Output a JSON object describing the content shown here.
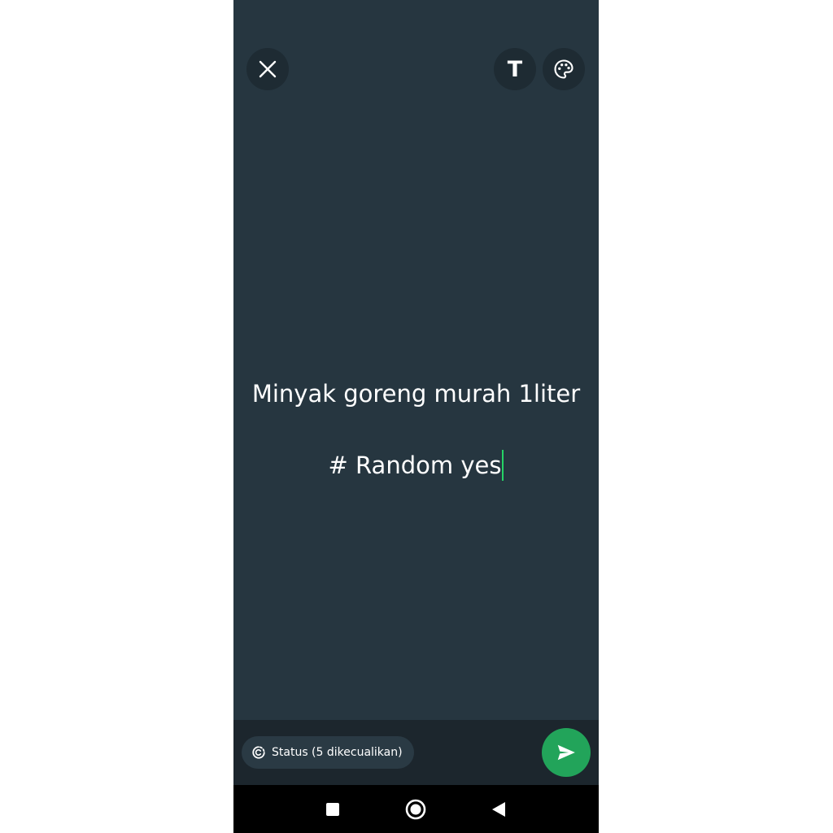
{
  "top_bar": {
    "close_icon": "close-icon",
    "text_icon": "text-format-icon",
    "text_button_glyph": "T",
    "palette_icon": "palette-icon"
  },
  "status": {
    "lines": [
      "Minyak goreng murah 1liter",
      "# Random yes"
    ],
    "text_color": "#ffffff",
    "caret_color": "#25d366",
    "background_color": "#263640"
  },
  "composer": {
    "audience_label": "Status (5 dikecualikan)",
    "audience_icon": "privacy-ring-icon",
    "send_icon": "send-icon",
    "send_color": "#22a45a"
  },
  "nav_bar": {
    "recents_icon": "recents-square-icon",
    "home_icon": "home-circle-icon",
    "back_icon": "back-triangle-icon"
  }
}
